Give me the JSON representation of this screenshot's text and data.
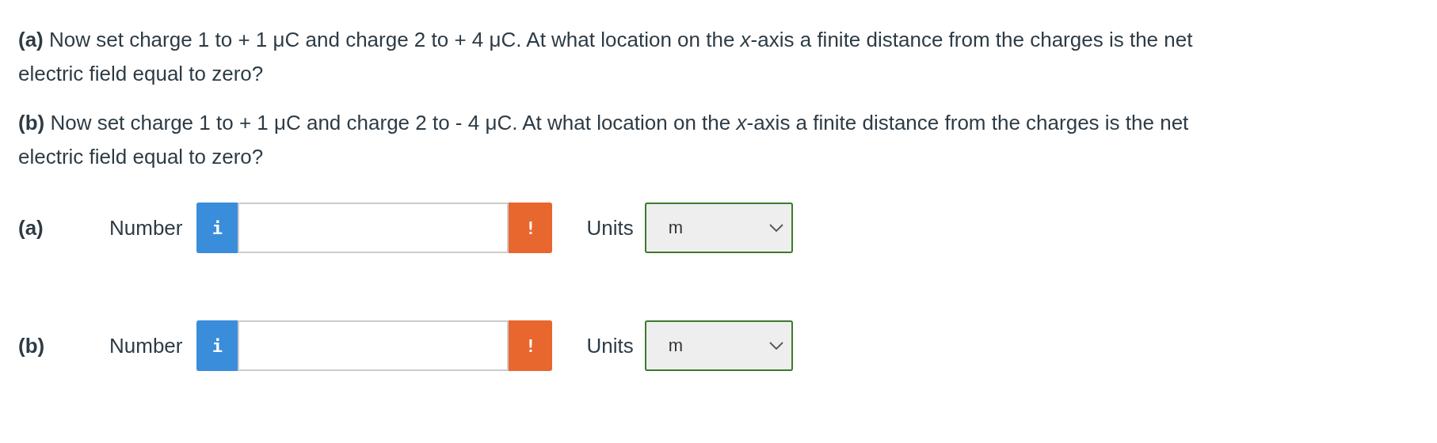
{
  "questions": [
    {
      "text": "**(a)** Now set charge 1 to + 1 μC and charge 2 to + 4 μC. At what location on the *x*-axis a finite distance from the charges is the net electric field equal to zero?"
    },
    {
      "text": "**(b)** Now set charge 1 to + 1 μC and charge 2 to - 4 μC. At what location on the *x*-axis a finite distance from the charges is the net electric field equal to zero?"
    }
  ],
  "answers": [
    {
      "part": "(a)",
      "label": "Number",
      "info": "i",
      "warning": "!",
      "units_label": "Units",
      "units": "m"
    },
    {
      "part": "(b)",
      "label": "Number",
      "info": "i",
      "warning": "!",
      "units_label": "Units",
      "units": "m"
    }
  ]
}
